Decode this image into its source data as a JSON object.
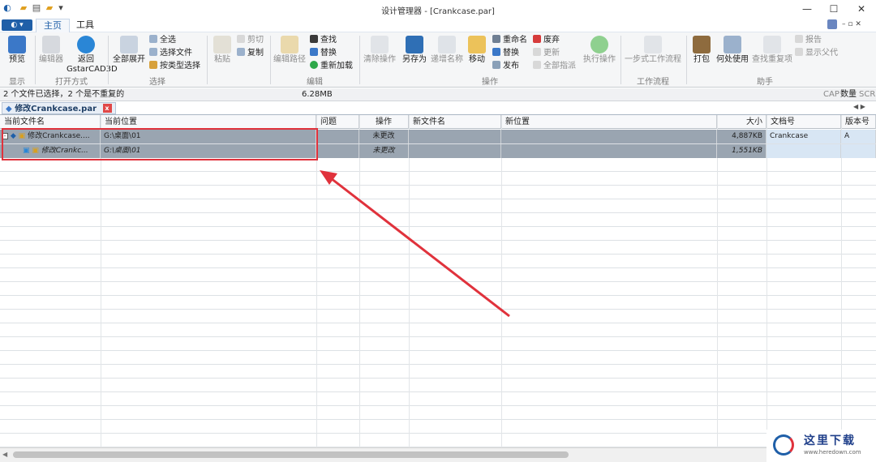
{
  "window": {
    "title": "设计管理器 - [Crankcase.par]"
  },
  "ribbon_tabs": [
    "主页",
    "工具"
  ],
  "ribbon": {
    "display": {
      "preview": "预览",
      "group": "显示"
    },
    "open_with": {
      "editor": "编辑器",
      "back": "返回\nGstarCAD3D",
      "group": "打开方式"
    },
    "select": {
      "expand_all": "全部展开",
      "select_all": "全选",
      "select_files": "选择文件",
      "select_by_type": "按类型选择",
      "group": "选择"
    },
    "clipboard": {
      "paste": "粘贴",
      "cut": "剪切",
      "copy": "复制"
    },
    "edit": {
      "edit_path": "编辑路径",
      "find": "查找",
      "replace": "替换",
      "reload": "重新加载",
      "group": "编辑"
    },
    "operation": {
      "clear": "清除操作",
      "save_as": "另存为",
      "increment_name": "递增名称",
      "move": "移动",
      "rename": "重命名",
      "replace": "替换",
      "publish": "发布",
      "discard": "废弃",
      "update": "更新",
      "assign_all": "全部指派",
      "execute": "执行操作",
      "group": "操作"
    },
    "workflow": {
      "one_step": "一步式工作流程",
      "group": "工作流程"
    },
    "assistant": {
      "pack": "打包",
      "where_used": "何处使用",
      "find_dup": "查找重复项",
      "report": "报告",
      "show_parent": "显示父代",
      "group": "助手"
    }
  },
  "status": {
    "selection": "2 个文件已选择，2 个是不重复的",
    "size": "6.28MB",
    "cap": "CAP",
    "num": "数量",
    "scrl": "SCRL"
  },
  "doc_tab": {
    "label": "修改Crankcase.par",
    "close": "x"
  },
  "table": {
    "columns": [
      "当前文件名",
      "当前位置",
      "问题",
      "操作",
      "新文件名",
      "新位置",
      "大小",
      "文档号",
      "版本号"
    ],
    "rows": [
      {
        "name": "修改Crankcase....",
        "location": "G:\\桌面\\01",
        "issue": "",
        "action": "未更改",
        "new_name": "",
        "new_location": "",
        "size": "4,887KB",
        "doc_no": "Crankcase",
        "rev": "A"
      },
      {
        "name": "修改Crankc...",
        "location": "G:\\桌面\\01",
        "issue": "",
        "action": "未更改",
        "new_name": "",
        "new_location": "",
        "size": "1,551KB",
        "doc_no": "",
        "rev": ""
      }
    ]
  },
  "watermark": {
    "text": "这里下载",
    "url": "www.heredown.com"
  },
  "colors": {
    "accent": "#1f5fa8",
    "row_selected": "#9aa5b1",
    "highlight_box": "#e0323c",
    "arrow": "#e0323c"
  }
}
